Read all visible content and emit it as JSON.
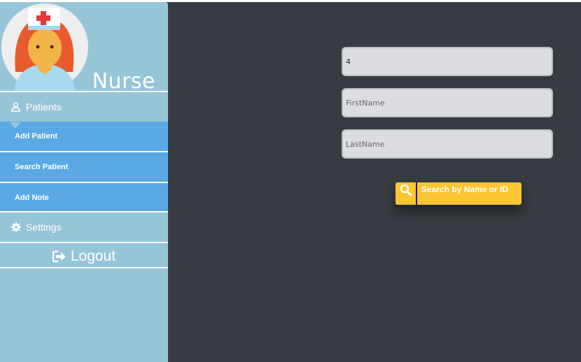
{
  "sidebar": {
    "role_title": "Nurse",
    "avatar_icon": "nurse-avatar-icon",
    "sections": {
      "patients": {
        "label": "Patients",
        "icon": "user-icon"
      },
      "settings": {
        "label": "Settings",
        "icon": "gear-icon"
      }
    },
    "items": [
      {
        "label": "Add Patient"
      },
      {
        "label": "Search Patient"
      },
      {
        "label": "Add Note"
      }
    ],
    "logout": {
      "label": "Logout",
      "icon": "sign-out-icon"
    }
  },
  "form": {
    "id_field": {
      "value": "4"
    },
    "first_name": {
      "placeholder": "FirstName"
    },
    "last_name": {
      "placeholder": "LastName"
    },
    "search_button": {
      "label": "Search by Name or ID",
      "icon": "search-icon"
    }
  },
  "colors": {
    "sidebar_bg": "#97c5d8",
    "menu_item_bg": "#5aa9e4",
    "main_bg": "#373c42",
    "button_bg": "#fcc531"
  }
}
